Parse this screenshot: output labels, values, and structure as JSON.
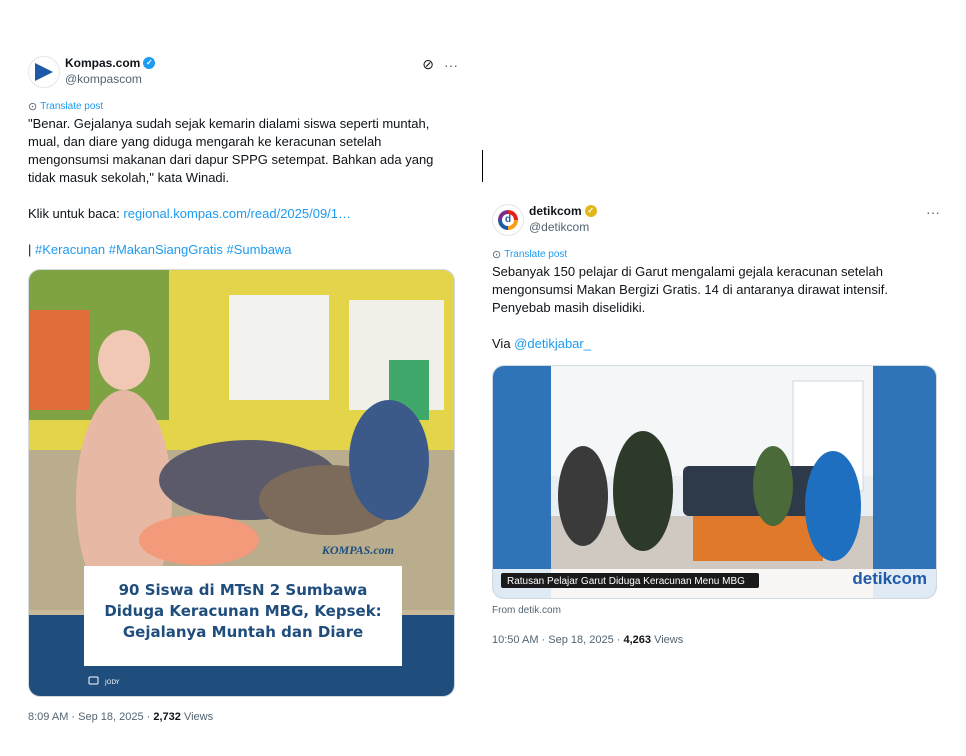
{
  "tweet1": {
    "display_name": "Kompas.com",
    "handle": "@kompascom",
    "verified_color": "#1d9bf0",
    "translate_label": "Translate post",
    "text_lines": [
      "\"Benar. Gejalanya sudah sejak kemarin dialami siswa seperti muntah,",
      "mual, dan diare yang diduga mengarah ke keracunan setelah",
      "mengonsumsi makanan dari dapur SPPG setempat. Bahkan ada yang",
      "tidak masuk sekolah,\" kata Winadi."
    ],
    "link_prefix": "Klik untuk baca: ",
    "link_text": "regional.kompas.com/read/2025/09/1…",
    "hashtag_prefix": "| ",
    "hashtags": "#Keracunan #MakanSiangGratis #Sumbawa",
    "image": {
      "logo_text": "KOMPAS.com",
      "headline_lines": [
        "90 Siswa di MTsN 2 Sumbawa",
        "Diduga Keracunan MBG, Kepsek:",
        "Gejalanya Muntah dan Diare"
      ],
      "credit": "JODY"
    },
    "time": "8:09 AM · Sep 18, 2025 · ",
    "views_count": "2,732",
    "views_label": " Views"
  },
  "tweet2": {
    "display_name": "detikcom",
    "handle": "@detikcom",
    "verified_color": "#e2b719",
    "translate_label": "Translate post",
    "text_lines": [
      "Sebanyak 150 pelajar di Garut mengalami gejala keracunan setelah",
      "mengonsumsi Makan Bergizi Gratis. 14 di antaranya dirawat intensif.",
      "Penyebab masih diselidiki."
    ],
    "via_prefix": "Via ",
    "via_link": "@detikjabar_",
    "image": {
      "caption": "Ratusan Pelajar Garut Diduga Keracunan Menu MBG",
      "logo_text": "detikcom"
    },
    "card_source": "From detik.com",
    "time": "10:50 AM · Sep 18, 2025 · ",
    "views_count": "4,263",
    "views_label": " Views"
  }
}
